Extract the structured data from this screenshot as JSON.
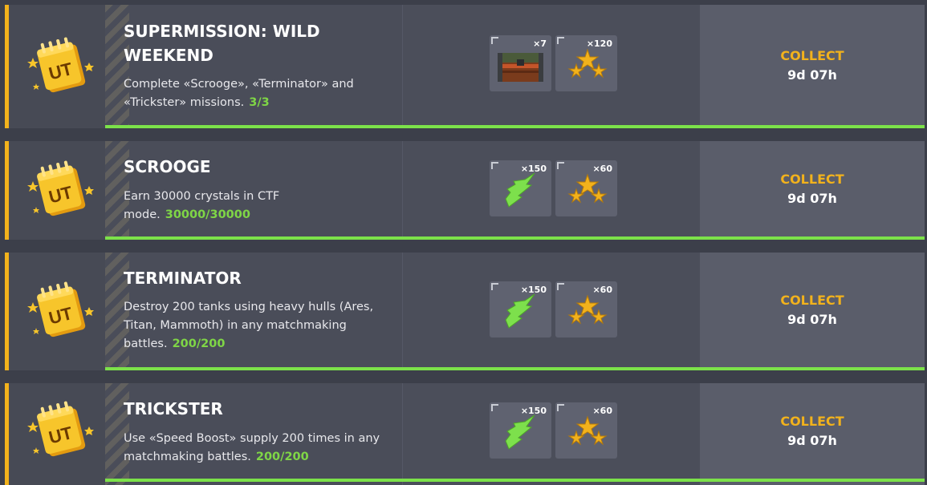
{
  "missions": [
    {
      "title": "SUPERMISSION: WILD WEEKEND",
      "description": "Complete «Scrooge», «Terminator» and «Trickster» missions.",
      "progress": "3/3",
      "progress_fraction": 1.0,
      "icon": "ut-calendar-icon",
      "rewards": [
        {
          "icon": "container-chest-icon",
          "quantity": "×7"
        },
        {
          "icon": "stars-icon",
          "quantity": "×120"
        }
      ],
      "action": "COLLECT",
      "time_left": "9d 07h"
    },
    {
      "title": "SCROOGE",
      "description": "Earn 30000 crystals in CTF mode.",
      "progress": "30000/30000",
      "progress_fraction": 1.0,
      "icon": "ut-calendar-icon",
      "rewards": [
        {
          "icon": "crystal-icon",
          "quantity": "×150"
        },
        {
          "icon": "stars-icon",
          "quantity": "×60"
        }
      ],
      "action": "COLLECT",
      "time_left": "9d 07h"
    },
    {
      "title": "TERMINATOR",
      "description": "Destroy 200 tanks using heavy hulls (Ares, Titan, Mammoth) in any matchmaking battles.",
      "progress": "200/200",
      "progress_fraction": 1.0,
      "icon": "ut-calendar-icon",
      "rewards": [
        {
          "icon": "crystal-icon",
          "quantity": "×150"
        },
        {
          "icon": "stars-icon",
          "quantity": "×60"
        }
      ],
      "action": "COLLECT",
      "time_left": "9d 07h"
    },
    {
      "title": "TRICKSTER",
      "description": "Use «Speed Boost» supply 200 times in any matchmaking battles.",
      "progress": "200/200",
      "progress_fraction": 1.0,
      "icon": "ut-calendar-icon",
      "rewards": [
        {
          "icon": "crystal-icon",
          "quantity": "×150"
        },
        {
          "icon": "stars-icon",
          "quantity": "×60"
        }
      ],
      "action": "COLLECT",
      "time_left": "9d 07h"
    }
  ],
  "colors": {
    "accent": "#f2b21c",
    "progress": "#7fd646",
    "progress_bar": "#7ce24a"
  }
}
